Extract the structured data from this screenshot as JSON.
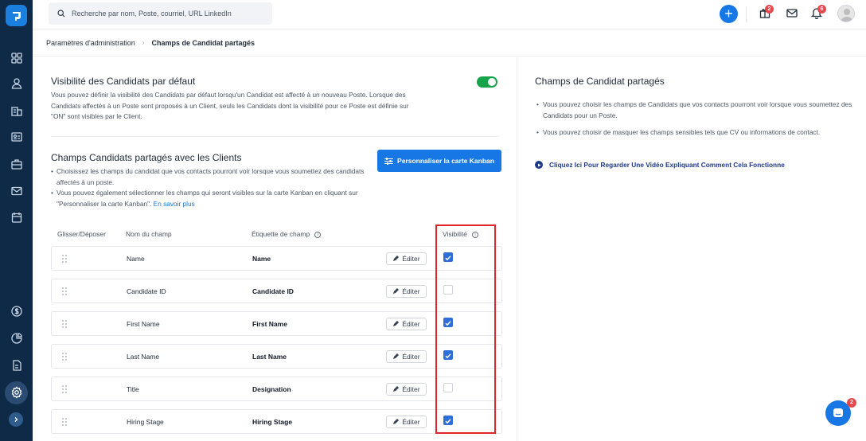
{
  "search": {
    "placeholder": "Recherche par nom, Poste, courriel, URL LinkedIn"
  },
  "topbar": {
    "add_label": "+",
    "badges": {
      "gift": "2",
      "bell": "6"
    },
    "icons": [
      "plus-icon",
      "gift-icon",
      "mail-icon",
      "bell-icon",
      "avatar"
    ]
  },
  "sidebar": {
    "icons": [
      "dashboard-icon",
      "candidates-icon",
      "companies-icon",
      "contacts-icon",
      "jobs-icon",
      "mail-icon",
      "calendar-icon",
      "dollar-icon",
      "reports-icon",
      "documents-icon",
      "settings-icon",
      "expand-icon"
    ],
    "active": "settings-icon"
  },
  "breadcrumb": {
    "parent": "Paramètres d'administration",
    "separator": "›",
    "current": "Champs de Candidat partagés"
  },
  "visibility": {
    "title": "Visibilité des Candidats par défaut",
    "description": "Vous pouvez définir la visibilité des Candidats par défaut lorsqu'un Candidat est affecté à un nouveau Poste. Lorsque des Candidats affectés à un Poste sont proposés à un Client, seuls les Candidats dont la visibilité pour ce Poste est définie sur \"ON\" sont visibles par le Client.",
    "toggle_on": true
  },
  "shared": {
    "title": "Champs Candidats partagés avec les Clients",
    "kanban_button": "Personnaliser la carte Kanban",
    "bullet1": "Choisissez les champs du candidat que vos contacts pourront voir lorsque vous soumettez des candidats affectés à un poste.",
    "bullet2": "Vous pouvez également sélectionner les champs qui seront visibles sur la carte Kanban en cliquant sur \"Personnaliser la carte Kanban\".",
    "learn_more": "En savoir plus"
  },
  "table": {
    "headers": {
      "drag": "Glisser/Déposer",
      "field": "Nom du champ",
      "label": "Étiquette de champ",
      "visibility": "Visibilité"
    },
    "edit_label": "Éditer",
    "rows": [
      {
        "field": "Name",
        "label": "Name",
        "visible": true
      },
      {
        "field": "Candidate ID",
        "label": "Candidate ID",
        "visible": false
      },
      {
        "field": "First Name",
        "label": "First Name",
        "visible": true
      },
      {
        "field": "Last Name",
        "label": "Last Name",
        "visible": true
      },
      {
        "field": "Title",
        "label": "Designation",
        "visible": false
      },
      {
        "field": "Hiring Stage",
        "label": "Hiring Stage",
        "visible": true
      }
    ]
  },
  "right_panel": {
    "title": "Champs de Candidat partagés",
    "bullet1": "Vous pouvez choisir les champs de Candidats que vos contacts pourront voir lorsque vous soumettez des Candidats pour un Poste.",
    "bullet2": "Vous pouvez choisir de masquer les champs sensibles tels que CV ou informations de contact.",
    "video_link": "Cliquez Ici Pour Regarder Une Vidéo Expliquant Comment Cela Fonctionne"
  },
  "chat": {
    "badge": "2"
  },
  "colors": {
    "accent": "#1677e5",
    "sidebar": "#0e2a47",
    "toggle": "#16a34a",
    "highlight": "#e0262b"
  }
}
